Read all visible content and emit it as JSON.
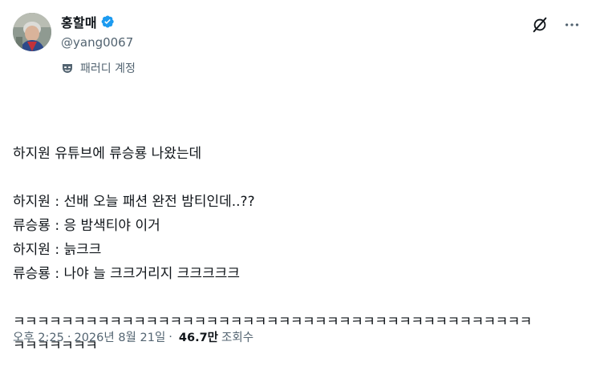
{
  "author": {
    "display_name": "홍할매",
    "handle": "@yang0067",
    "parody_label": "패러디 계정"
  },
  "icons": {
    "verified": "verified-badge-icon",
    "parody": "parody-mask-icon",
    "grok": "grok-icon",
    "more": "more-options-icon"
  },
  "colors": {
    "verified_blue": "#1d9bf0",
    "secondary_text": "#536471",
    "primary_text": "#0f1419"
  },
  "tweet": {
    "lines": [
      "하지원 유튜브에 류승룡 나왔는데",
      "",
      "하지원 : 선배 오늘 패션 완전 밤티인데..??",
      "류승룡 : 응 밤색티야 이거",
      "하지원 : 늙크크",
      "류승룡 : 나야 늘 크크거리지 크크크크크",
      "",
      "ㅋㅋㅋㅋㅋㅋㅋㅋㅋㅋㅋㅋㅋㅋㅋㅋㅋㅋㅋㅋㅋㅋㅋㅋㅋㅋㅋㅋㅋㅋㅋㅋㅋㅋㅋㅋㅋㅋㅋㅋㅋㅋㅋ",
      "ㅋㅋㅋㅋㅋㅋㅋ"
    ]
  },
  "meta": {
    "time": "오후 2:25",
    "separator": "·",
    "date": "2026년 8월 21일",
    "views_count": "46.7만",
    "views_label": "조회수"
  }
}
